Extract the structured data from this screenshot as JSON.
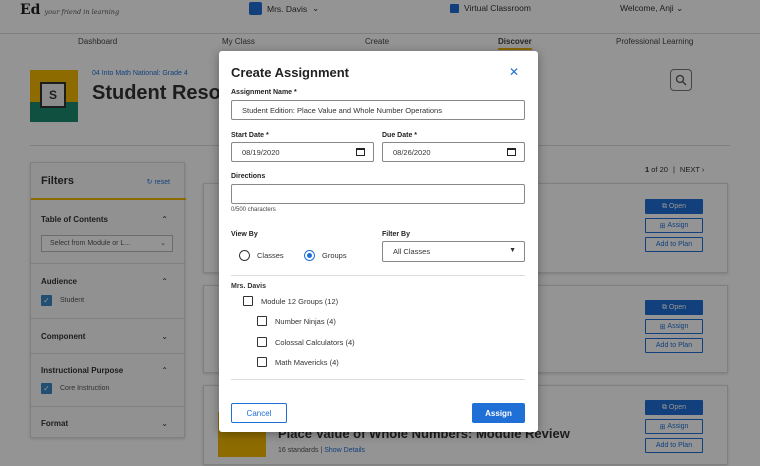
{
  "header": {
    "logo": "Ed",
    "tagline": "your friend in learning",
    "user_menu": "Mrs. Davis",
    "virtual_classroom": "Virtual Classroom",
    "welcome": "Welcome, Anji"
  },
  "nav": {
    "items": [
      "Dashboard",
      "My Class",
      "Create",
      "Discover",
      "Professional Learning"
    ],
    "active": "Discover"
  },
  "resource": {
    "breadcrumb": "04 Into Math National: Grade 4",
    "title": "Student Resources",
    "book_letter": "S"
  },
  "filters": {
    "title": "Filters",
    "reset": "reset",
    "toc": {
      "label": "Table of Contents",
      "select_placeholder": "Select from Module or L..."
    },
    "audience": {
      "label": "Audience",
      "checked": "Student"
    },
    "component": {
      "label": "Component"
    },
    "instructional_purpose": {
      "label": "Instructional Purpose",
      "checked": "Core Instruction"
    },
    "format": {
      "label": "Format"
    }
  },
  "pager": {
    "current": "1",
    "total": "20",
    "next": "NEXT"
  },
  "cards": {
    "open": "Open",
    "assign": "Assign",
    "add_to_plan": "Add to Plan",
    "last_title": "Place Value of Whole Numbers: Module Review",
    "last_standards": "16 standards",
    "last_details": "Show Details"
  },
  "modal": {
    "title": "Create Assignment",
    "assignment_name_label": "Assignment Name *",
    "assignment_name_value": "Student Edition: Place Value and Whole Number Operations",
    "start_date_label": "Start Date *",
    "start_date_value": "08/19/2020",
    "due_date_label": "Due Date *",
    "due_date_value": "08/26/2020",
    "directions_label": "Directions",
    "directions_value": "",
    "char_count": "0/500 characters",
    "view_by_label": "View By",
    "view_by_options": [
      "Classes",
      "Groups"
    ],
    "view_by_selected": "Groups",
    "filter_by_label": "Filter By",
    "filter_by_value": "All Classes",
    "teacher": "Mrs. Davis",
    "groups": [
      {
        "label": "Module 12 Groups (12)",
        "level": 0
      },
      {
        "label": "Number Ninjas (4)",
        "level": 1
      },
      {
        "label": "Colossal Calculators (4)",
        "level": 1
      },
      {
        "label": "Math Mavericks (4)",
        "level": 1
      }
    ],
    "cancel": "Cancel",
    "assign": "Assign"
  },
  "colors": {
    "accent": "#1f6fd6",
    "brand_yellow": "#f5b800",
    "overlay": "rgba(0,0,0,0.42)"
  }
}
